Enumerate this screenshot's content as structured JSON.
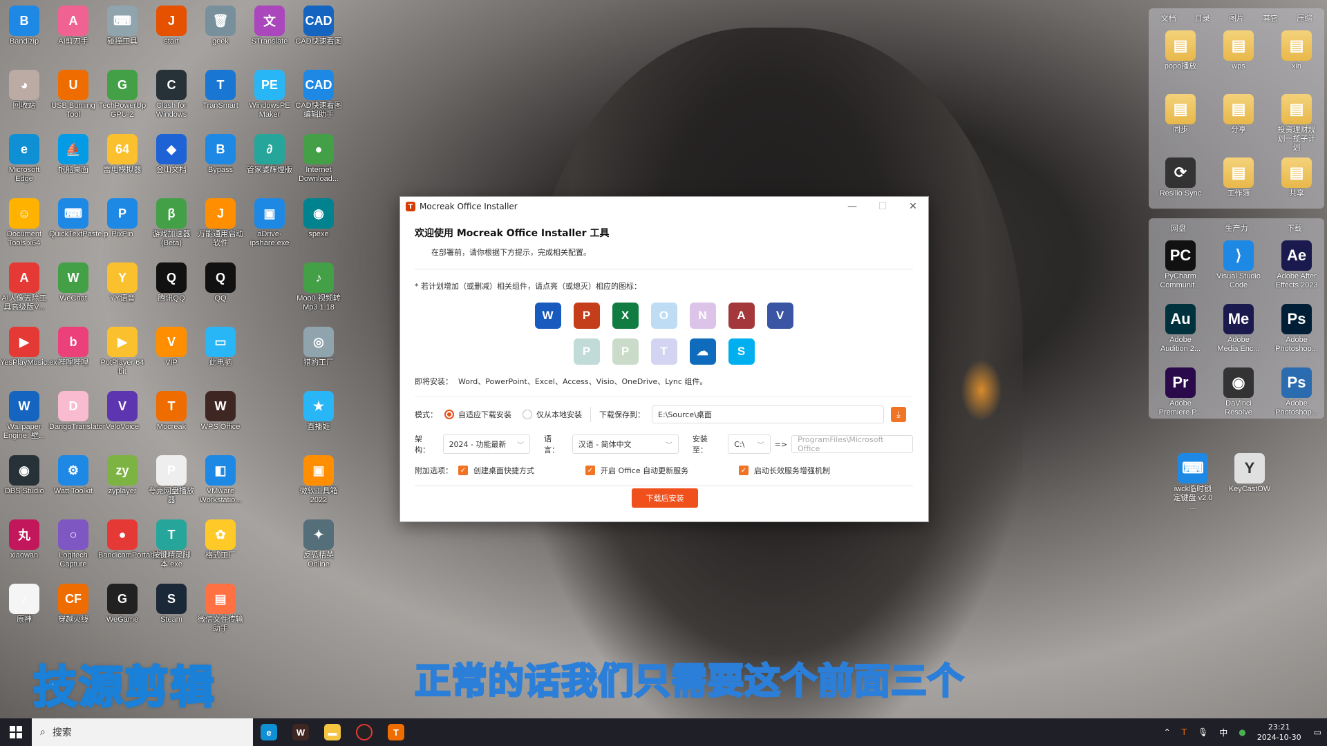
{
  "desktop": {
    "icons": [
      {
        "label": "Bandizip",
        "color": "#1e88e5",
        "glyph": "B"
      },
      {
        "label": "AI剪刀手",
        "color": "#f06292",
        "glyph": "A"
      },
      {
        "label": "碰撞工具",
        "color": "#90a4ae",
        "glyph": "⌨"
      },
      {
        "label": "start",
        "color": "#e65100",
        "glyph": "J"
      },
      {
        "label": "geek",
        "color": "#78909c",
        "glyph": "🗑"
      },
      {
        "label": "STranslate",
        "color": "#ab47bc",
        "glyph": "文"
      },
      {
        "label": "CAD快速看图",
        "color": "#1565c0",
        "glyph": "CAD"
      },
      {
        "label": "回收站",
        "color": "#bcaaa4",
        "glyph": "◕"
      },
      {
        "label": "USB Burning Tool",
        "color": "#ef6c00",
        "glyph": "U"
      },
      {
        "label": "TechPowerUp GPU-Z",
        "color": "#43a047",
        "glyph": "G"
      },
      {
        "label": "Clash for Windows",
        "color": "#263238",
        "glyph": "C"
      },
      {
        "label": "TranSmart",
        "color": "#1976d2",
        "glyph": "T"
      },
      {
        "label": "WindowsPE Maker",
        "color": "#29b6f6",
        "glyph": "PE"
      },
      {
        "label": "CAD快速看图编辑助手",
        "color": "#1e88e5",
        "glyph": "CAD"
      },
      {
        "label": "Microsoft Edge",
        "color": "#0f8fd4",
        "glyph": "e"
      },
      {
        "label": "帆船桌面",
        "color": "#039be5",
        "glyph": "⛵"
      },
      {
        "label": "雷电模拟器",
        "color": "#fbc02d",
        "glyph": "64"
      },
      {
        "label": "金山文档",
        "color": "#1e63d6",
        "glyph": "◆"
      },
      {
        "label": "Bypass",
        "color": "#1e88e5",
        "glyph": "B"
      },
      {
        "label": "管家婆辉煌版",
        "color": "#26a69a",
        "glyph": "∂"
      },
      {
        "label": "Internet Download...",
        "color": "#43a047",
        "glyph": "●"
      },
      {
        "label": "Document Tools x64",
        "color": "#ffb300",
        "glyph": "☺"
      },
      {
        "label": "QuickTextPaste.p",
        "color": "#1e88e5",
        "glyph": "⌨"
      },
      {
        "label": "PixPin",
        "color": "#1e88e5",
        "glyph": "P"
      },
      {
        "label": "游戏加速器(Beta)",
        "color": "#43a047",
        "glyph": "β"
      },
      {
        "label": "万能通用启动软件",
        "color": "#ff8f00",
        "glyph": "J"
      },
      {
        "label": "aDrive-ipshare.exe",
        "color": "#1e88e5",
        "glyph": "▣"
      },
      {
        "label": "spexe",
        "color": "#00838f",
        "glyph": "◉"
      },
      {
        "label": "AI人像去除工具高级版V...",
        "color": "#e53935",
        "glyph": "A"
      },
      {
        "label": "WeChat",
        "color": "#43a047",
        "glyph": "W"
      },
      {
        "label": "YY语音",
        "color": "#fbc02d",
        "glyph": "Y"
      },
      {
        "label": "腾讯QQ",
        "color": "#111111",
        "glyph": "Q"
      },
      {
        "label": "QQ",
        "color": "#111111",
        "glyph": "Q"
      },
      {
        "label": "",
        "color": "#000000",
        "glyph": ""
      },
      {
        "label": "Moo0 视频转Mp3 1.18",
        "color": "#43a047",
        "glyph": "♪"
      },
      {
        "label": "YesPlayMusic.exe",
        "color": "#e53935",
        "glyph": "▶"
      },
      {
        "label": "哔哩哔哩",
        "color": "#ec407a",
        "glyph": "b"
      },
      {
        "label": "PotPlayer 64 bit",
        "color": "#fbc02d",
        "glyph": "▶"
      },
      {
        "label": "VIP",
        "color": "#ff8f00",
        "glyph": "V"
      },
      {
        "label": "此电脑",
        "color": "#29b6f6",
        "glyph": "▭"
      },
      {
        "label": "",
        "color": "#000000",
        "glyph": ""
      },
      {
        "label": "猎豹工厂",
        "color": "#90a4ae",
        "glyph": "◎"
      },
      {
        "label": "Wallpaper Engine: 壁...",
        "color": "#1565c0",
        "glyph": "W"
      },
      {
        "label": "DangoTranslator",
        "color": "#f8bbd0",
        "glyph": "D"
      },
      {
        "label": "VeloVoice",
        "color": "#5e35b1",
        "glyph": "V"
      },
      {
        "label": "Mocreak",
        "color": "#ef6c00",
        "glyph": "T"
      },
      {
        "label": "WPS Office",
        "color": "#3e2723",
        "glyph": "W"
      },
      {
        "label": "",
        "color": "#000000",
        "glyph": ""
      },
      {
        "label": "直播姬",
        "color": "#29b6f6",
        "glyph": "★"
      },
      {
        "label": "OBS Studio",
        "color": "#263238",
        "glyph": "◉"
      },
      {
        "label": "Watt Toolkit",
        "color": "#1e88e5",
        "glyph": "⚙"
      },
      {
        "label": "zyplayer",
        "color": "#7cb342",
        "glyph": "zy"
      },
      {
        "label": "夸克网盘播放器",
        "color": "#eeeeee",
        "glyph": "P"
      },
      {
        "label": "VMware Workstatio...",
        "color": "#1e88e5",
        "glyph": "◧"
      },
      {
        "label": "",
        "color": "#000000",
        "glyph": ""
      },
      {
        "label": "微软工具箱2022",
        "color": "#ff8f00",
        "glyph": "▣"
      },
      {
        "label": "xiaowan",
        "color": "#c2185b",
        "glyph": "丸"
      },
      {
        "label": "Logitech Capture",
        "color": "#7e57c2",
        "glyph": "○"
      },
      {
        "label": "BandicamPortable.exe",
        "color": "#e53935",
        "glyph": "●"
      },
      {
        "label": "按键精灵脚本.exe",
        "color": "#26a69a",
        "glyph": "T"
      },
      {
        "label": "格式工厂",
        "color": "#ffca28",
        "glyph": "✿"
      },
      {
        "label": "",
        "color": "#000000",
        "glyph": ""
      },
      {
        "label": "反恐精英Online",
        "color": "#546e7a",
        "glyph": "✦"
      },
      {
        "label": "原神",
        "color": "#f5f5f5",
        "glyph": "♪"
      },
      {
        "label": "穿越火线",
        "color": "#ef6c00",
        "glyph": "CF"
      },
      {
        "label": "WeGame",
        "color": "#212121",
        "glyph": "G"
      },
      {
        "label": "Steam",
        "color": "#1b2838",
        "glyph": "S"
      },
      {
        "label": "微信文件传输助手",
        "color": "#ff7043",
        "glyph": "▤"
      }
    ]
  },
  "right_panel_top": {
    "tabs": [
      "文档",
      "目录",
      "图片",
      "其它",
      "压缩"
    ],
    "items": [
      {
        "label": "popo播放",
        "glyph": "▤",
        "folder": true
      },
      {
        "label": "wps",
        "glyph": "▤",
        "folder": true
      },
      {
        "label": "xin",
        "glyph": "▤",
        "folder": true
      },
      {
        "label": "同步",
        "glyph": "▤",
        "folder": true
      },
      {
        "label": "分享",
        "glyph": "▤",
        "folder": true
      },
      {
        "label": "投资理财规划一揽子计划",
        "glyph": "▤",
        "folder": true
      },
      {
        "label": "Resilio Sync",
        "glyph": "⟳",
        "folder": false
      },
      {
        "label": "工作簿",
        "glyph": "▤",
        "folder": true
      },
      {
        "label": "共享",
        "glyph": "▤",
        "folder": true
      }
    ]
  },
  "right_panel_bottom": {
    "tabs": [
      "网盘",
      "生产力",
      "下载"
    ],
    "items": [
      {
        "label": "PyCharm Communit...",
        "glyph": "PC",
        "color": "#111111"
      },
      {
        "label": "Visual Studio Code",
        "glyph": "⟩",
        "color": "#1e88e5"
      },
      {
        "label": "Adobe After Effects 2023",
        "glyph": "Ae",
        "color": "#1a1a4e"
      },
      {
        "label": "Adobe Audition 2...",
        "glyph": "Au",
        "color": "#00323d"
      },
      {
        "label": "Adobe Media Enc...",
        "glyph": "Me",
        "color": "#1a1a4e"
      },
      {
        "label": "Adobe Photoshop...",
        "glyph": "Ps",
        "color": "#001e36"
      },
      {
        "label": "Adobe Premiere P...",
        "glyph": "Pr",
        "color": "#2a0a4a"
      },
      {
        "label": "DaVinci Resolve",
        "glyph": "◉",
        "color": "#333333"
      },
      {
        "label": "Adobe Photoshop...",
        "glyph": "Ps",
        "color": "#2b6cb0"
      }
    ]
  },
  "right_extra": [
    {
      "label": "iwck临时锁定键盘 v2.0 ...",
      "glyph": "⌨",
      "color": "#1e88e5"
    },
    {
      "label": "KeyCastOW",
      "glyph": "Y",
      "color": "#e0e0e0"
    }
  ],
  "window": {
    "title": "Mocreak Office Installer",
    "heading": "欢迎使用 Mocreak Office Installer 工具",
    "subheading": "在部署前，请你根据下方提示，完成相关配置。",
    "hint": "* 若计划增加（或删减）相关组件，请点亮（或熄灭）相应的图标：",
    "apps_row1": [
      {
        "name": "word-icon",
        "glyph": "W",
        "color": "#185abd",
        "dim": false
      },
      {
        "name": "powerpoint-icon",
        "glyph": "P",
        "color": "#c43e1c",
        "dim": false
      },
      {
        "name": "excel-icon",
        "glyph": "X",
        "color": "#107c41",
        "dim": false
      },
      {
        "name": "outlook-icon",
        "glyph": "O",
        "color": "#0078d4",
        "dim": true
      },
      {
        "name": "onenote-icon",
        "glyph": "N",
        "color": "#7719aa",
        "dim": true
      },
      {
        "name": "access-icon",
        "glyph": "A",
        "color": "#a4373a",
        "dim": false
      },
      {
        "name": "visio-icon",
        "glyph": "V",
        "color": "#3955a3",
        "dim": false
      }
    ],
    "apps_row2": [
      {
        "name": "publisher-icon",
        "glyph": "P",
        "color": "#077568",
        "dim": true
      },
      {
        "name": "project-icon",
        "glyph": "P",
        "color": "#31752f",
        "dim": true
      },
      {
        "name": "teams-icon",
        "glyph": "T",
        "color": "#5059c9",
        "dim": true
      },
      {
        "name": "onedrive-icon",
        "glyph": "☁",
        "color": "#0f6cbd",
        "dim": false
      },
      {
        "name": "skype-icon",
        "glyph": "S",
        "color": "#00aff0",
        "dim": false
      }
    ],
    "installing_label": "即将安装：",
    "installing_value": "Word、PowerPoint、Excel、Access、Visio、OneDrive、Lync 组件。",
    "mode_label": "模式：",
    "mode_option1": "自适应下载安装",
    "mode_option2": "仅从本地安装",
    "save_label": "下载保存到：",
    "save_path": "E:\\Source\\桌面",
    "arch_label": "架构：",
    "arch_value": "2024 - 功能最新",
    "lang_label": "语言：",
    "lang_value": "汉语 - 简体中文",
    "install_to_label": "安装至：",
    "install_drive": "C:\\",
    "arrow": "=>",
    "install_path_placeholder": "ProgramFiles\\Microsoft Office",
    "extra_label": "附加选项：",
    "opt1": "创建桌面快捷方式",
    "opt2": "开启 Office 自动更新服务",
    "opt3": "启动长效服务增强机制",
    "button": "下载后安装"
  },
  "overlay": {
    "logo": "技源剪辑",
    "caption": "正常的话我们只需要这个前面三个"
  },
  "taskbar": {
    "search_placeholder": "搜索",
    "ime": "中",
    "time": "23:21",
    "date": "2024-10-30"
  }
}
